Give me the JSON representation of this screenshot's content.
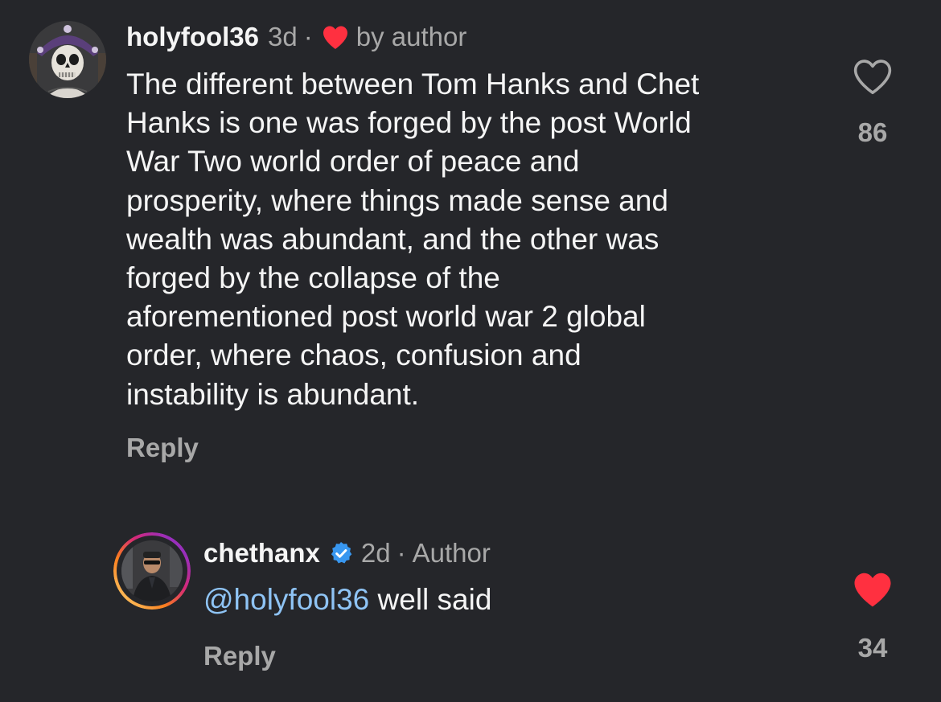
{
  "comments": [
    {
      "username": "holyfool36",
      "time": "3d",
      "separator": "·",
      "badge_text": "by author",
      "badge_icon": "heart-icon",
      "text": "The different between Tom Hanks and Chet\nHanks is one was forged by the post World\nWar Two world order of peace and\nprosperity, where things made sense and\nwealth was abundant, and the other was\nforged by the collapse of the\naforementioned post world war 2 global\norder, where chaos, confusion and\ninstability is abundant.",
      "reply_label": "Reply",
      "like_icon": "heart-outline-icon",
      "like_count": "86",
      "liked": false
    },
    {
      "username": "chethanx",
      "verified": true,
      "time": "2d",
      "separator": "·",
      "role": "Author",
      "mention": "@holyfool36",
      "text": " well said",
      "reply_label": "Reply",
      "like_icon": "heart-filled-icon",
      "like_count": "34",
      "liked": true
    }
  ],
  "colors": {
    "background": "#25262a",
    "heart_red": "#ff3040",
    "verified_blue": "#3897f0",
    "mention_blue": "#8fc4f5",
    "muted": "#a8a8a8"
  }
}
